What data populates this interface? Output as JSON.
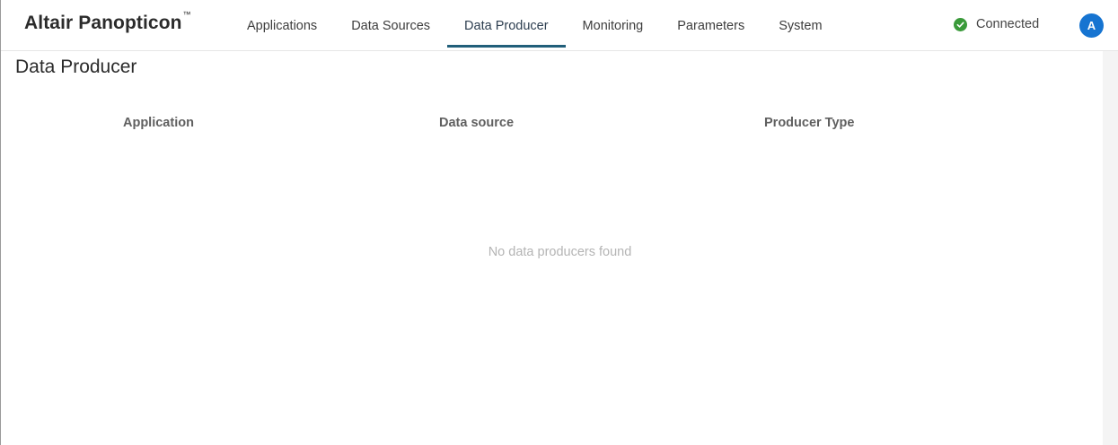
{
  "brand": {
    "name": "Altair Panopticon",
    "trademark": "™"
  },
  "nav": {
    "items": [
      {
        "label": "Applications",
        "active": false
      },
      {
        "label": "Data Sources",
        "active": false
      },
      {
        "label": "Data Producer",
        "active": true
      },
      {
        "label": "Monitoring",
        "active": false
      },
      {
        "label": "Parameters",
        "active": false
      },
      {
        "label": "System",
        "active": false
      }
    ]
  },
  "status": {
    "label": "Connected",
    "icon": "check-circle-icon",
    "color": "#3a9a3a"
  },
  "user": {
    "initial": "A",
    "color": "#1674d1"
  },
  "page": {
    "title": "Data Producer"
  },
  "table": {
    "columns": [
      "Application",
      "Data source",
      "Producer Type"
    ],
    "empty_message": "No data producers found"
  },
  "colors": {
    "accent": "#215f7a"
  }
}
